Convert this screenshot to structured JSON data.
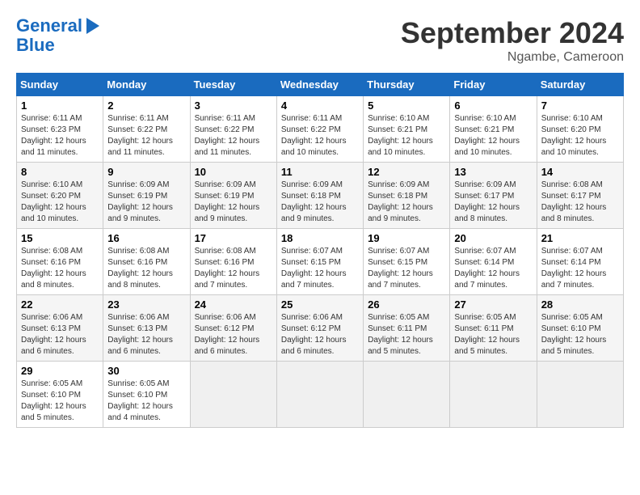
{
  "logo": {
    "line1": "General",
    "line2": "Blue"
  },
  "title": "September 2024",
  "location": "Ngambe, Cameroon",
  "days_of_week": [
    "Sunday",
    "Monday",
    "Tuesday",
    "Wednesday",
    "Thursday",
    "Friday",
    "Saturday"
  ],
  "weeks": [
    [
      {
        "day": "1",
        "sunrise": "6:11 AM",
        "sunset": "6:23 PM",
        "daylight": "12 hours and 11 minutes."
      },
      {
        "day": "2",
        "sunrise": "6:11 AM",
        "sunset": "6:22 PM",
        "daylight": "12 hours and 11 minutes."
      },
      {
        "day": "3",
        "sunrise": "6:11 AM",
        "sunset": "6:22 PM",
        "daylight": "12 hours and 11 minutes."
      },
      {
        "day": "4",
        "sunrise": "6:11 AM",
        "sunset": "6:22 PM",
        "daylight": "12 hours and 10 minutes."
      },
      {
        "day": "5",
        "sunrise": "6:10 AM",
        "sunset": "6:21 PM",
        "daylight": "12 hours and 10 minutes."
      },
      {
        "day": "6",
        "sunrise": "6:10 AM",
        "sunset": "6:21 PM",
        "daylight": "12 hours and 10 minutes."
      },
      {
        "day": "7",
        "sunrise": "6:10 AM",
        "sunset": "6:20 PM",
        "daylight": "12 hours and 10 minutes."
      }
    ],
    [
      {
        "day": "8",
        "sunrise": "6:10 AM",
        "sunset": "6:20 PM",
        "daylight": "12 hours and 10 minutes."
      },
      {
        "day": "9",
        "sunrise": "6:09 AM",
        "sunset": "6:19 PM",
        "daylight": "12 hours and 9 minutes."
      },
      {
        "day": "10",
        "sunrise": "6:09 AM",
        "sunset": "6:19 PM",
        "daylight": "12 hours and 9 minutes."
      },
      {
        "day": "11",
        "sunrise": "6:09 AM",
        "sunset": "6:18 PM",
        "daylight": "12 hours and 9 minutes."
      },
      {
        "day": "12",
        "sunrise": "6:09 AM",
        "sunset": "6:18 PM",
        "daylight": "12 hours and 9 minutes."
      },
      {
        "day": "13",
        "sunrise": "6:09 AM",
        "sunset": "6:17 PM",
        "daylight": "12 hours and 8 minutes."
      },
      {
        "day": "14",
        "sunrise": "6:08 AM",
        "sunset": "6:17 PM",
        "daylight": "12 hours and 8 minutes."
      }
    ],
    [
      {
        "day": "15",
        "sunrise": "6:08 AM",
        "sunset": "6:16 PM",
        "daylight": "12 hours and 8 minutes."
      },
      {
        "day": "16",
        "sunrise": "6:08 AM",
        "sunset": "6:16 PM",
        "daylight": "12 hours and 8 minutes."
      },
      {
        "day": "17",
        "sunrise": "6:08 AM",
        "sunset": "6:16 PM",
        "daylight": "12 hours and 7 minutes."
      },
      {
        "day": "18",
        "sunrise": "6:07 AM",
        "sunset": "6:15 PM",
        "daylight": "12 hours and 7 minutes."
      },
      {
        "day": "19",
        "sunrise": "6:07 AM",
        "sunset": "6:15 PM",
        "daylight": "12 hours and 7 minutes."
      },
      {
        "day": "20",
        "sunrise": "6:07 AM",
        "sunset": "6:14 PM",
        "daylight": "12 hours and 7 minutes."
      },
      {
        "day": "21",
        "sunrise": "6:07 AM",
        "sunset": "6:14 PM",
        "daylight": "12 hours and 7 minutes."
      }
    ],
    [
      {
        "day": "22",
        "sunrise": "6:06 AM",
        "sunset": "6:13 PM",
        "daylight": "12 hours and 6 minutes."
      },
      {
        "day": "23",
        "sunrise": "6:06 AM",
        "sunset": "6:13 PM",
        "daylight": "12 hours and 6 minutes."
      },
      {
        "day": "24",
        "sunrise": "6:06 AM",
        "sunset": "6:12 PM",
        "daylight": "12 hours and 6 minutes."
      },
      {
        "day": "25",
        "sunrise": "6:06 AM",
        "sunset": "6:12 PM",
        "daylight": "12 hours and 6 minutes."
      },
      {
        "day": "26",
        "sunrise": "6:05 AM",
        "sunset": "6:11 PM",
        "daylight": "12 hours and 5 minutes."
      },
      {
        "day": "27",
        "sunrise": "6:05 AM",
        "sunset": "6:11 PM",
        "daylight": "12 hours and 5 minutes."
      },
      {
        "day": "28",
        "sunrise": "6:05 AM",
        "sunset": "6:10 PM",
        "daylight": "12 hours and 5 minutes."
      }
    ],
    [
      {
        "day": "29",
        "sunrise": "6:05 AM",
        "sunset": "6:10 PM",
        "daylight": "12 hours and 5 minutes."
      },
      {
        "day": "30",
        "sunrise": "6:05 AM",
        "sunset": "6:10 PM",
        "daylight": "12 hours and 4 minutes."
      },
      null,
      null,
      null,
      null,
      null
    ]
  ]
}
